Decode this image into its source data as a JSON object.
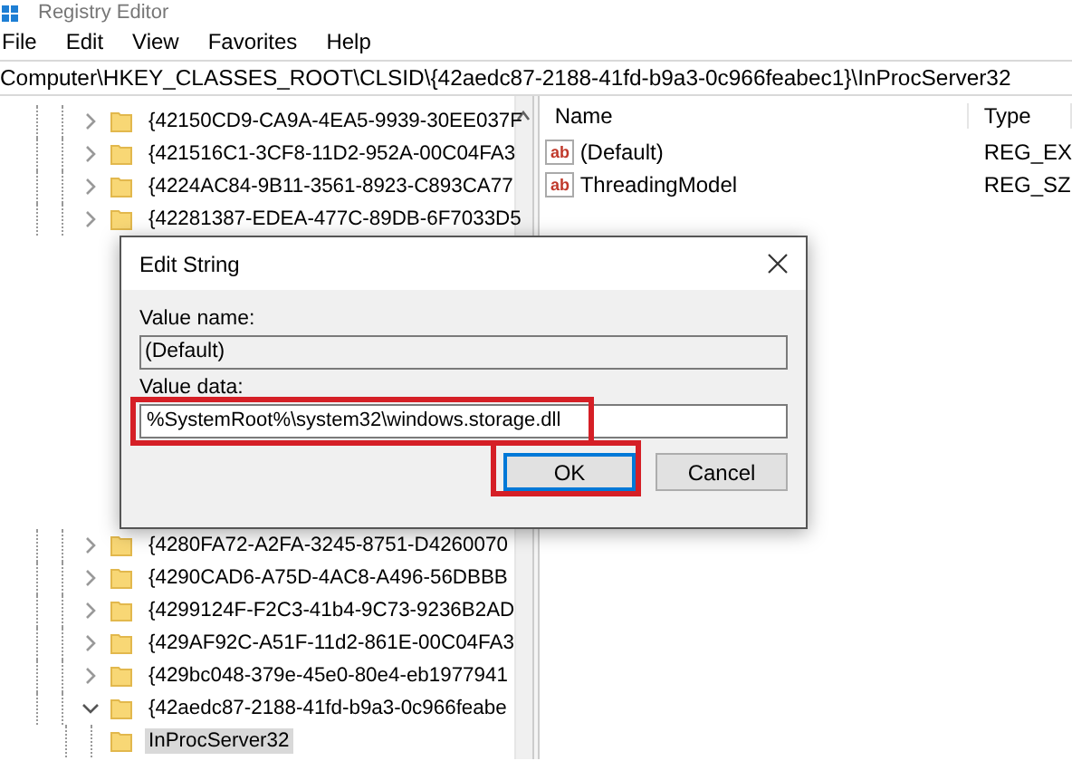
{
  "window": {
    "title": "Registry Editor"
  },
  "menu": [
    "File",
    "Edit",
    "View",
    "Favorites",
    "Help"
  ],
  "address_bar": {
    "value": "Computer\\HKEY_CLASSES_ROOT\\CLSID\\{42aedc87-2188-41fd-b9a3-0c966feabec1}\\InProcServer32"
  },
  "tree": {
    "items_top": [
      {
        "label": "{42150CD9-CA9A-4EA5-9939-30EE037F",
        "expanded": false,
        "selected": false
      },
      {
        "label": "{421516C1-3CF8-11D2-952A-00C04FA3",
        "expanded": false,
        "selected": false
      },
      {
        "label": "{4224AC84-9B11-3561-8923-C893CA77",
        "expanded": false,
        "selected": false
      },
      {
        "label": "{42281387-EDEA-477C-89DB-6F7033D5",
        "expanded": false,
        "selected": false
      }
    ],
    "items_bottom": [
      {
        "label": "{4280FA72-A2FA-3245-8751-D4260070",
        "expanded": false,
        "selected": false
      },
      {
        "label": "{4290CAD6-A75D-4AC8-A496-56DBBB",
        "expanded": false,
        "selected": false
      },
      {
        "label": "{4299124F-F2C3-41b4-9C73-9236B2AD",
        "expanded": false,
        "selected": false
      },
      {
        "label": "{429AF92C-A51F-11d2-861E-00C04FA3",
        "expanded": false,
        "selected": false
      },
      {
        "label": "{429bc048-379e-45e0-80e4-eb1977941",
        "expanded": false,
        "selected": false
      },
      {
        "label": "{42aedc87-2188-41fd-b9a3-0c966feabe",
        "expanded": true,
        "selected": false,
        "children": [
          {
            "label": "InProcServer32",
            "selected": true
          }
        ]
      }
    ]
  },
  "values_table": {
    "columns": [
      "Name",
      "Type"
    ],
    "rows": [
      {
        "icon": "ab",
        "name": "(Default)",
        "type": "REG_EX"
      },
      {
        "icon": "ab",
        "name": "ThreadingModel",
        "type": "REG_SZ"
      }
    ]
  },
  "dialog": {
    "title": "Edit String",
    "value_name_label": "Value name:",
    "value_name": "(Default)",
    "value_data_label": "Value data:",
    "value_data": "%SystemRoot%\\system32\\windows.storage.dll",
    "value_data_highlighted": true,
    "buttons": [
      {
        "label": "OK",
        "default": true,
        "highlighted": true
      },
      {
        "label": "Cancel",
        "default": false,
        "highlighted": false
      }
    ]
  }
}
